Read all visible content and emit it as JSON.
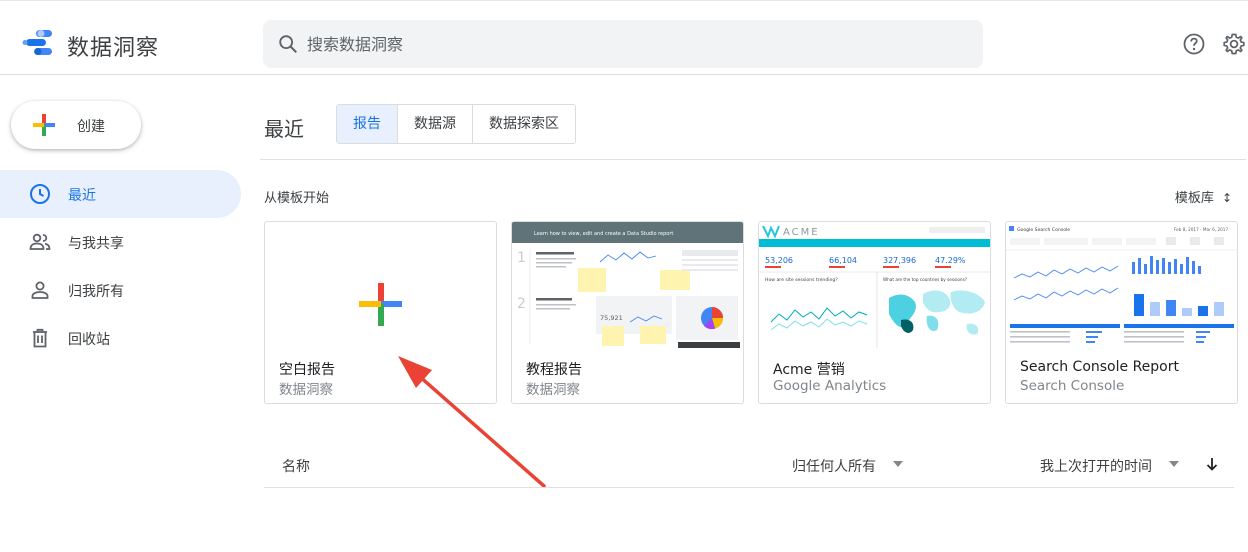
{
  "app": {
    "title": "数据洞察"
  },
  "search": {
    "placeholder": "搜索数据洞察"
  },
  "top_icons": [
    "help-icon",
    "settings-icon"
  ],
  "create": {
    "label": "创建"
  },
  "sidebar": {
    "items": [
      {
        "label": "最近",
        "icon": "clock-icon",
        "active": true
      },
      {
        "label": "与我共享",
        "icon": "people-icon",
        "active": false
      },
      {
        "label": "归我所有",
        "icon": "person-icon",
        "active": false
      },
      {
        "label": "回收站",
        "icon": "trash-icon",
        "active": false
      }
    ]
  },
  "main": {
    "title": "最近",
    "tabs": [
      {
        "label": "报告",
        "active": true
      },
      {
        "label": "数据源",
        "active": false
      },
      {
        "label": "数据探索区",
        "active": false
      }
    ],
    "templates_label": "从模板开始",
    "gallery_label": "模板库",
    "templates": [
      {
        "title": "空白报告",
        "subtitle": "数据洞察"
      },
      {
        "title": "教程报告",
        "subtitle": "数据洞察"
      },
      {
        "title": "Acme 营销",
        "subtitle": "Google Analytics"
      },
      {
        "title": "Search Console Report",
        "subtitle": "Search Console"
      }
    ],
    "tutorial_thumb": {
      "header": "Learn how to view, edit and create a Data Studio report",
      "number": "75,921"
    },
    "acme_thumb": {
      "brand": "ACME",
      "metrics": [
        "53,206",
        "66,104",
        "327,396",
        "47.29%"
      ],
      "q1": "How are site sessions trending?",
      "q2": "What are the top countries by sessions?"
    },
    "sc_thumb": {
      "title": "Google Search Console",
      "date": "Feb 8, 2017 - Mar 6, 2017"
    },
    "list": {
      "name_col": "名称",
      "owner_col": "归任何人所有",
      "time_col": "我上次打开的时间"
    }
  },
  "colors": {
    "accent": "#1a73e8",
    "active_bg": "#e8f0fe",
    "arrow": "#ea4335"
  }
}
